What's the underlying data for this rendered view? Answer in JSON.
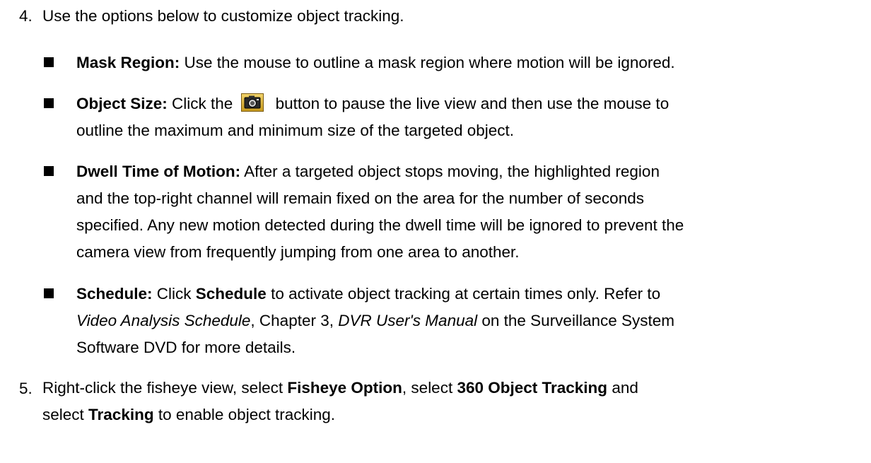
{
  "step4": {
    "number": "4.",
    "text": "Use the options below to customize object tracking."
  },
  "bullets": {
    "mask": {
      "label": "Mask Region:",
      "text": " Use the mouse to outline a mask region where motion will be ignored."
    },
    "objsize": {
      "label": "Object Size:",
      "text_before": " Click the",
      "text_after": " button to pause the live view and then use the mouse to",
      "line2": "outline the maximum and minimum size of the targeted object.",
      "icon": "camera-snapshot-icon"
    },
    "dwell": {
      "label": "Dwell Time of Motion:",
      "line1": " After a targeted object stops moving, the highlighted region",
      "line2": "and the top-right channel will remain fixed on the area for the number of seconds",
      "line3": "specified. Any new motion detected during the dwell time will be ignored to prevent the",
      "line4": "camera view from frequently jumping from one area to another."
    },
    "schedule": {
      "label": "Schedule:",
      "l1_a": " Click ",
      "l1_bold": "Schedule",
      "l1_b": " to activate object tracking at certain times only. Refer to",
      "l2_italic1": "Video Analysis Schedule",
      "l2_a": ", Chapter 3, ",
      "l2_italic2": "DVR User's Manual",
      "l2_b": " on the Surveillance System",
      "line3": "Software DVD for more details."
    }
  },
  "step5": {
    "number": "5.",
    "l1_a": "Right-click the fisheye view, select ",
    "l1_bold1": "Fisheye Option",
    "l1_b": ", select ",
    "l1_bold2": "360 Object Tracking",
    "l1_c": " and",
    "l2_a": "select ",
    "l2_bold": "Tracking",
    "l2_b": " to enable object tracking."
  }
}
